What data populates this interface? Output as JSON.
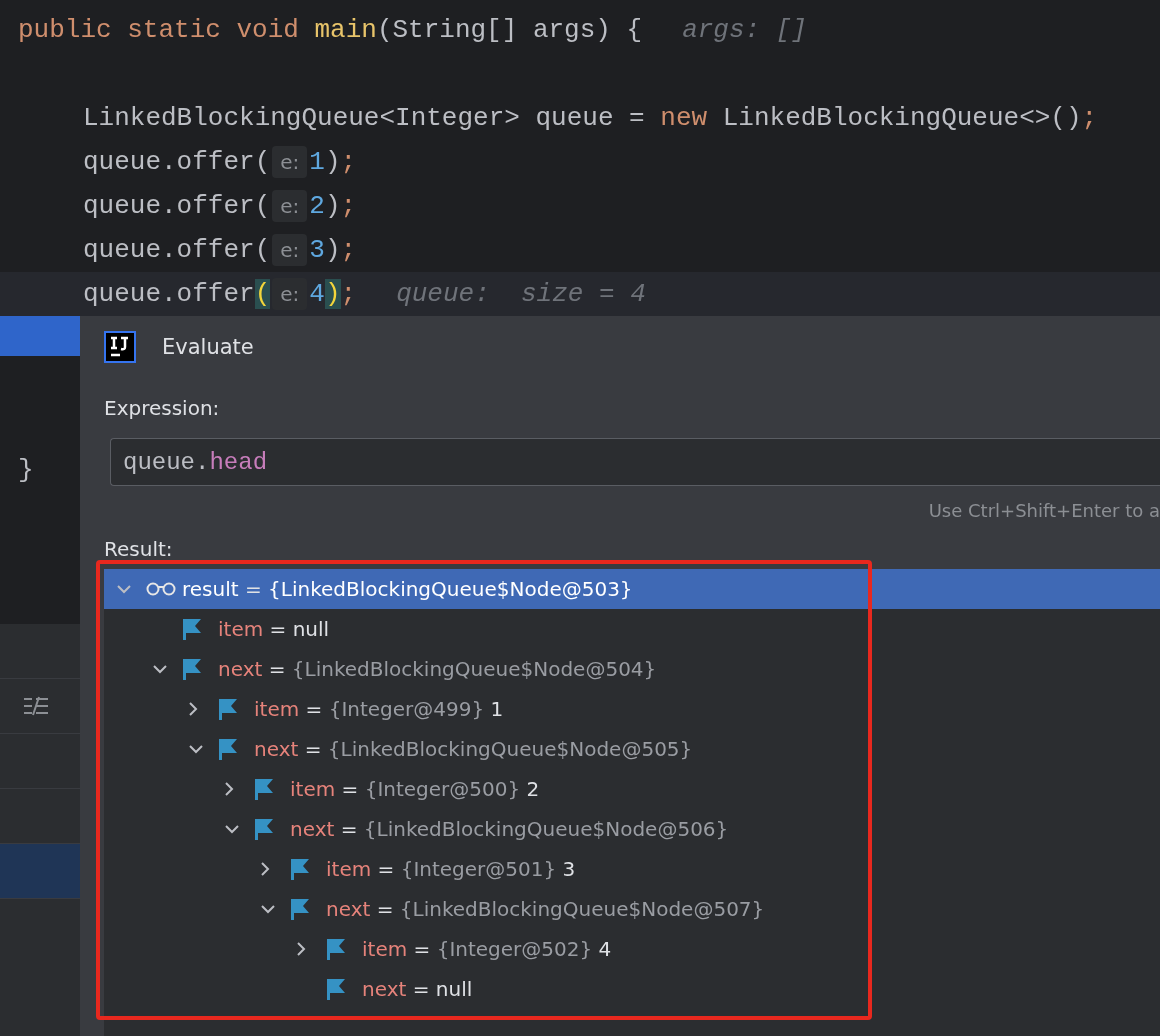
{
  "editor": {
    "lines": [
      {
        "kind": "signature",
        "current": false,
        "tokens": [
          {
            "t": "public static void ",
            "kind": "keyword"
          },
          {
            "t": "main",
            "kind": "method"
          },
          {
            "t": "(String[] args) {",
            "kind": "plain"
          },
          {
            "t": "args: []",
            "kind": "hint"
          }
        ]
      },
      {
        "kind": "blank",
        "current": false
      },
      {
        "kind": "body",
        "current": false,
        "tokens": [
          {
            "t": "LinkedBlockingQueue<Integer> queue = ",
            "kind": "plain"
          },
          {
            "t": "new ",
            "kind": "keyword"
          },
          {
            "t": "LinkedBlockingQueue<>()",
            "kind": "plain"
          },
          {
            "t": ";",
            "kind": "keyword"
          }
        ]
      },
      {
        "kind": "body",
        "current": false,
        "tokens": [
          {
            "t": "queue.offer(",
            "kind": "plain"
          },
          {
            "t": "e:",
            "kind": "param"
          },
          {
            "t": "1",
            "kind": "number"
          },
          {
            "t": ")",
            "kind": "plain"
          },
          {
            "t": ";",
            "kind": "keyword"
          }
        ]
      },
      {
        "kind": "body",
        "current": false,
        "tokens": [
          {
            "t": "queue.offer(",
            "kind": "plain"
          },
          {
            "t": "e:",
            "kind": "param"
          },
          {
            "t": "2",
            "kind": "number"
          },
          {
            "t": ")",
            "kind": "plain"
          },
          {
            "t": ";",
            "kind": "keyword"
          }
        ]
      },
      {
        "kind": "body",
        "current": false,
        "tokens": [
          {
            "t": "queue.offer(",
            "kind": "plain"
          },
          {
            "t": "e:",
            "kind": "param"
          },
          {
            "t": "3",
            "kind": "number"
          },
          {
            "t": ")",
            "kind": "plain"
          },
          {
            "t": ";",
            "kind": "keyword"
          }
        ]
      },
      {
        "kind": "body",
        "current": true,
        "tokens": [
          {
            "t": "queue.offer",
            "kind": "plain"
          },
          {
            "t": "(",
            "kind": "match"
          },
          {
            "t": "e:",
            "kind": "param"
          },
          {
            "t": "4",
            "kind": "number"
          },
          {
            "t": ")",
            "kind": "match"
          },
          {
            "t": ";",
            "kind": "keyword"
          },
          {
            "t": "queue:  size = 4",
            "kind": "hint"
          }
        ]
      }
    ],
    "closing_brace": "}"
  },
  "dialog": {
    "title": "Evaluate",
    "expression_label": "Expression:",
    "expression": [
      {
        "t": "queue.",
        "kind": "plain"
      },
      {
        "t": "head",
        "kind": "field"
      }
    ],
    "shortcut_hint": "Use Ctrl+Shift+Enter to a",
    "result_label": "Result:",
    "tree": [
      {
        "kind": "watch",
        "name": "result",
        "sign": "=",
        "type": "{LinkedBlockingQueue$Node@503}",
        "expandable": true,
        "expanded": true,
        "selected": true,
        "children": [
          {
            "kind": "field",
            "name": "item",
            "sign": "=",
            "value": "null",
            "expandable": false,
            "expanded": false,
            "selected": false
          },
          {
            "kind": "field",
            "name": "next",
            "sign": "=",
            "type": "{LinkedBlockingQueue$Node@504}",
            "expandable": true,
            "expanded": true,
            "selected": false,
            "children": [
              {
                "kind": "field",
                "name": "item",
                "sign": "=",
                "type": "{Integer@499}",
                "value": "1",
                "expandable": true,
                "expanded": false,
                "selected": false
              },
              {
                "kind": "field",
                "name": "next",
                "sign": "=",
                "type": "{LinkedBlockingQueue$Node@505}",
                "expandable": true,
                "expanded": true,
                "selected": false,
                "children": [
                  {
                    "kind": "field",
                    "name": "item",
                    "sign": "=",
                    "type": "{Integer@500}",
                    "value": "2",
                    "expandable": true,
                    "expanded": false,
                    "selected": false
                  },
                  {
                    "kind": "field",
                    "name": "next",
                    "sign": "=",
                    "type": "{LinkedBlockingQueue$Node@506}",
                    "expandable": true,
                    "expanded": true,
                    "selected": false,
                    "children": [
                      {
                        "kind": "field",
                        "name": "item",
                        "sign": "=",
                        "type": "{Integer@501}",
                        "value": "3",
                        "expandable": true,
                        "expanded": false,
                        "selected": false
                      },
                      {
                        "kind": "field",
                        "name": "next",
                        "sign": "=",
                        "type": "{LinkedBlockingQueue$Node@507}",
                        "expandable": true,
                        "expanded": true,
                        "selected": false,
                        "children": [
                          {
                            "kind": "field",
                            "name": "item",
                            "sign": "=",
                            "type": "{Integer@502}",
                            "value": "4",
                            "expandable": true,
                            "expanded": false,
                            "selected": false
                          },
                          {
                            "kind": "field",
                            "name": "next",
                            "sign": "=",
                            "value": "null",
                            "expandable": false,
                            "expanded": false,
                            "selected": false
                          }
                        ]
                      }
                    ]
                  }
                ]
              }
            ]
          }
        ]
      }
    ]
  }
}
